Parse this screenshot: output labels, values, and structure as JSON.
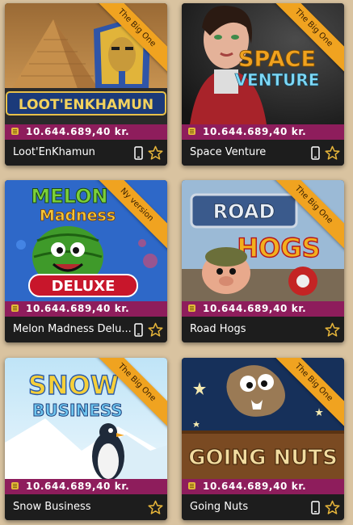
{
  "colors": {
    "page_background": "#d9c3a0",
    "jackpot_bar": "#8e1d5c",
    "footer_bar": "#1d1d1d",
    "ribbon": "#f0a320",
    "coin": "#e3b93a",
    "star": "#e6b53a"
  },
  "games": [
    {
      "name": "Loot'EnKhamun",
      "ribbon": "The Big One",
      "jackpot": "10.644.689,40 kr.",
      "logo": "LOOT'ENKHAMUN",
      "mobile": true,
      "icons": [
        "coin-icon",
        "mobile-icon",
        "star-icon"
      ]
    },
    {
      "name": "Space Venture",
      "ribbon": "The Big One",
      "jackpot": "10.644.689,40 kr.",
      "logo_top": "SPACE",
      "logo_bottom": "VENTURE",
      "mobile": true,
      "icons": [
        "coin-icon",
        "mobile-icon",
        "star-icon"
      ]
    },
    {
      "name": "Melon Madness Delu...",
      "ribbon": "Ny version",
      "jackpot": "10.644.689,40 kr.",
      "logo_top": "MELON",
      "logo_mid": "Madness",
      "logo_bottom": "DELUXE",
      "mobile": true,
      "icons": [
        "coin-icon",
        "mobile-icon",
        "star-icon"
      ]
    },
    {
      "name": "Road Hogs",
      "ribbon": "The Big One",
      "jackpot": "10.644.689,40 kr.",
      "logo_top": "ROAD",
      "logo_bottom": "HOGS",
      "mobile": false,
      "icons": [
        "coin-icon",
        "star-icon"
      ]
    },
    {
      "name": "Snow Business",
      "ribbon": "The Big One",
      "jackpot": "10.644.689,40 kr.",
      "logo_top": "SNOW",
      "logo_bottom": "BUSINESS",
      "mobile": false,
      "icons": [
        "coin-icon",
        "star-icon"
      ]
    },
    {
      "name": "Going Nuts",
      "ribbon": "The Big One",
      "jackpot": "10.644.689,40 kr.",
      "logo": "GOING NUTS",
      "mobile": true,
      "icons": [
        "coin-icon",
        "mobile-icon",
        "star-icon"
      ]
    }
  ]
}
